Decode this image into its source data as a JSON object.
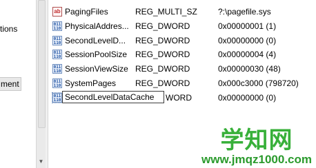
{
  "tree": {
    "items": [
      {
        "label": "tions"
      },
      {
        "label": "ment"
      }
    ]
  },
  "values": {
    "rows": [
      {
        "name": "PagingFiles",
        "type": "REG_MULTI_SZ",
        "data": "?:\\pagefile.sys",
        "icon": "string-value-icon"
      },
      {
        "name": "PhysicalAddres...",
        "type": "REG_DWORD",
        "data": "0x00000001 (1)",
        "icon": "dword-value-icon"
      },
      {
        "name": "SecondLevelD...",
        "type": "REG_DWORD",
        "data": "0x00000000 (0)",
        "icon": "dword-value-icon"
      },
      {
        "name": "SessionPoolSize",
        "type": "REG_DWORD",
        "data": "0x00000004 (4)",
        "icon": "dword-value-icon"
      },
      {
        "name": "SessionViewSize",
        "type": "REG_DWORD",
        "data": "0x00000030 (48)",
        "icon": "dword-value-icon"
      },
      {
        "name": "SystemPages",
        "type": "REG_DWORD",
        "data": "0x000c3000 (798720)",
        "icon": "dword-value-icon"
      }
    ],
    "editing_row": {
      "edit_value": "SecondLevelDataCache",
      "type_suffix": "WORD",
      "data": "0x00000000 (0)",
      "icon": "dword-value-icon"
    }
  },
  "watermark": {
    "title": "学知网",
    "url": "www.jmqz1000.com"
  },
  "colors": {
    "watermark_green": "#38b03a",
    "dword_icon_blue": "#1b4fa0",
    "string_icon_red": "#c0292b"
  }
}
